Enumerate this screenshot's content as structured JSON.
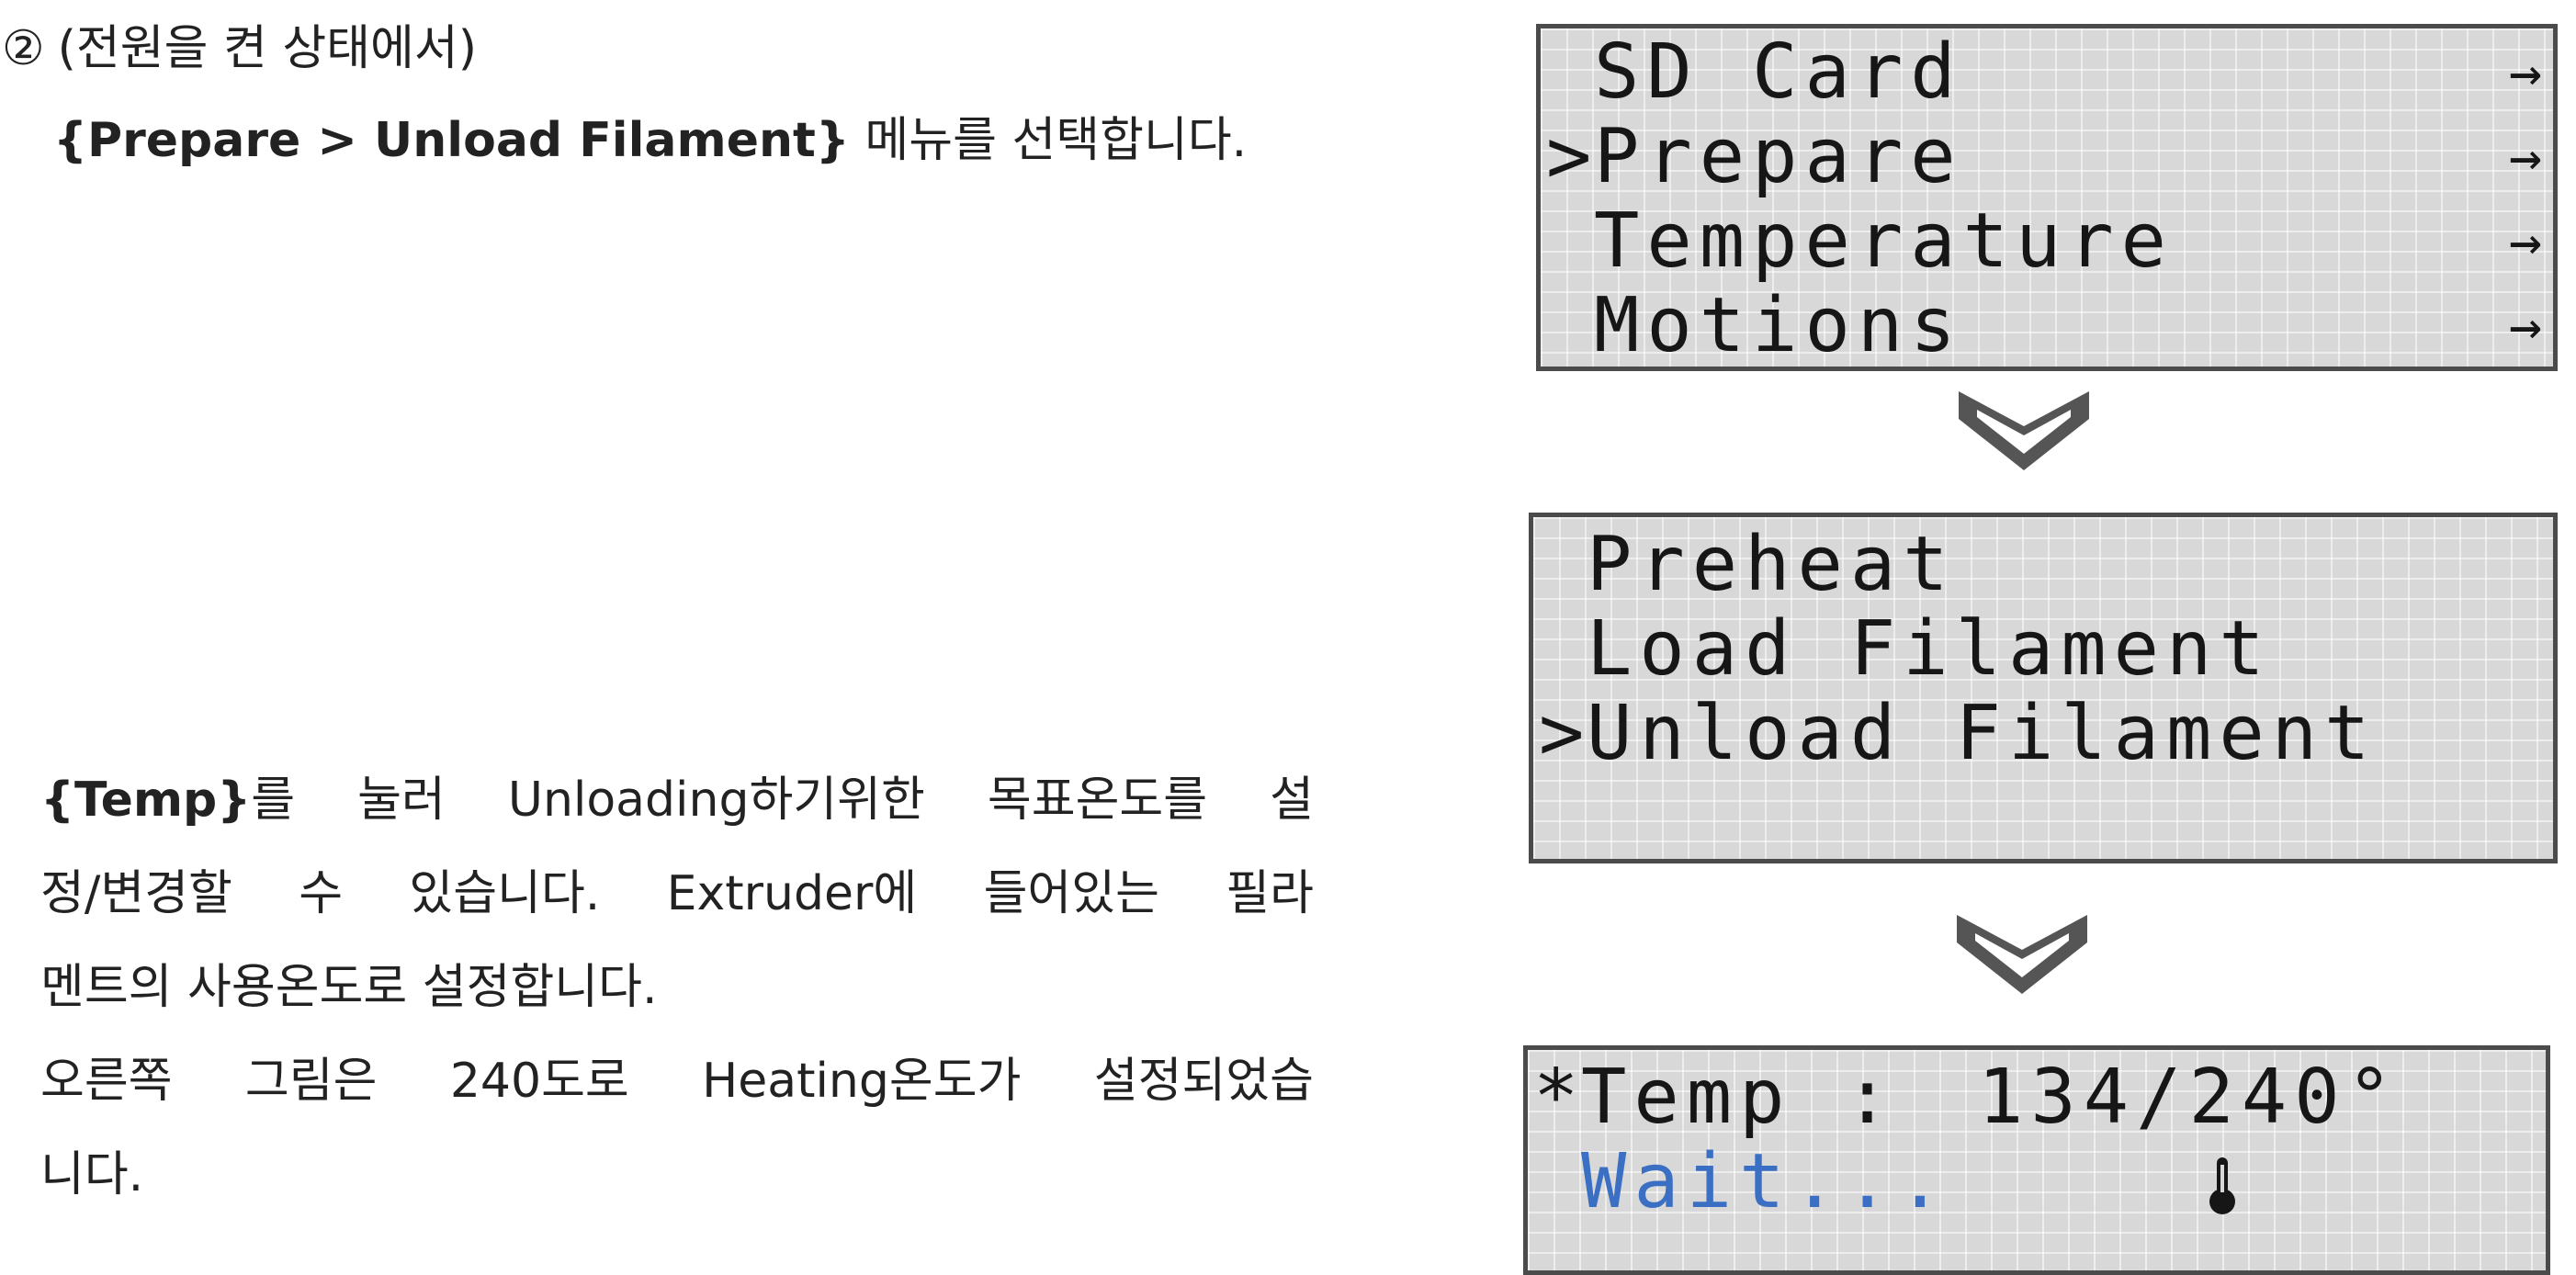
{
  "step": {
    "number": "②",
    "heading": "(전원을 켠 상태에서)",
    "instruction_bold": "{Prepare > Unload Filament}",
    "instruction_rest": "메뉴를 선택합니다."
  },
  "description": {
    "line1_bold": "{Temp}",
    "line1_words": [
      "를",
      "눌러",
      "Unloading하기위한",
      "목표온도를",
      "설"
    ],
    "line2_words": [
      "정/변경할",
      "수",
      "있습니다.",
      "Extruder에",
      "들어있는",
      "필라"
    ],
    "line3": "멘트의 사용온도로 설정합니다.",
    "line4_words": [
      "오른쪽",
      "그림은",
      "240도로",
      "Heating온도가",
      "설정되었습"
    ],
    "line5": "니다."
  },
  "lcd_main_menu": {
    "rows": [
      {
        "cursor": "",
        "label": "SD Card",
        "arrow": "→"
      },
      {
        "cursor": ">",
        "label": "Prepare",
        "arrow": "→"
      },
      {
        "cursor": "",
        "label": "Temperature",
        "arrow": "→"
      },
      {
        "cursor": "",
        "label": "Motions",
        "arrow": "→"
      }
    ]
  },
  "lcd_prepare_menu": {
    "rows": [
      {
        "cursor": "",
        "label": "Preheat"
      },
      {
        "cursor": "",
        "label": "Load Filament"
      },
      {
        "cursor": ">",
        "label": "Unload Filament"
      },
      {
        "cursor": "",
        "label": ""
      }
    ]
  },
  "lcd_status": {
    "marker": "*",
    "temp_label": "Temp :",
    "temp_icon": "thermometer-icon",
    "temp_value": "134/240°",
    "wait_text": "Wait...",
    "wait_color": "#3b6fc4"
  },
  "icons": {
    "arrow_down": "chevron-down-icon"
  }
}
